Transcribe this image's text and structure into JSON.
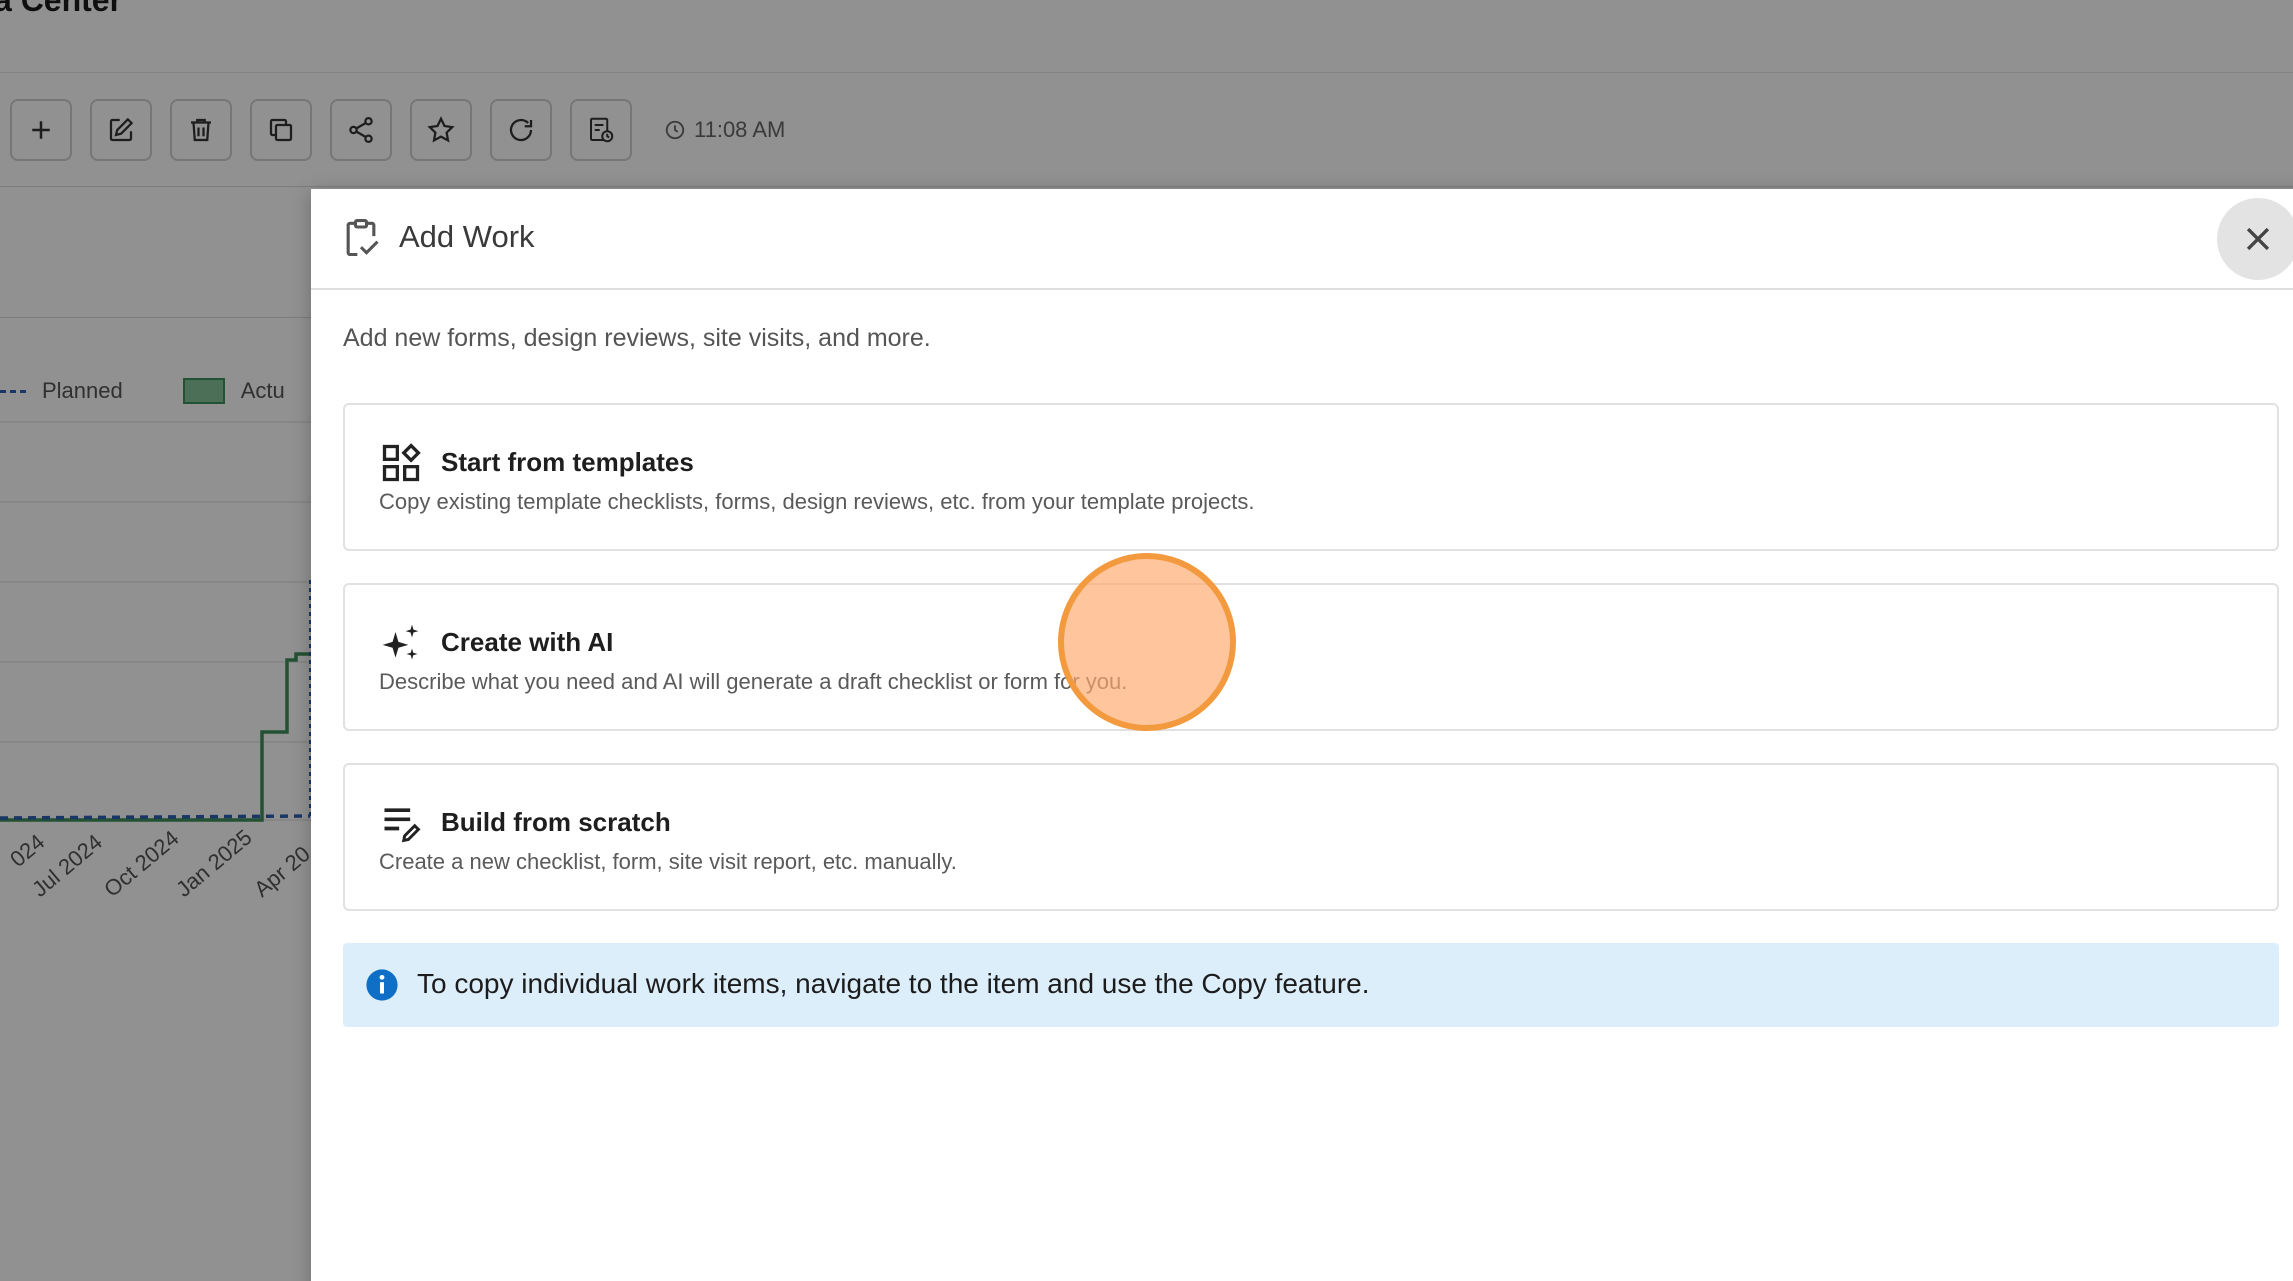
{
  "background": {
    "page_title": "a Center",
    "toolbar": {
      "buttons": [
        {
          "icon": "plus-icon"
        },
        {
          "icon": "edit-icon"
        },
        {
          "icon": "trash-icon"
        },
        {
          "icon": "copy-icon"
        },
        {
          "icon": "share-icon"
        },
        {
          "icon": "star-icon"
        },
        {
          "icon": "refresh-icon"
        },
        {
          "icon": "report-schedule-icon"
        }
      ],
      "time": "11:08 AM"
    },
    "chart": {
      "legend": {
        "planned": "Planned",
        "actual": "Actu"
      },
      "colors": {
        "planned": "#2f5fb3",
        "actual_fill": "#86c49b",
        "actual_line": "#3d8f5a"
      }
    }
  },
  "chart_data": {
    "type": "line",
    "x": [
      "024",
      "Jul 2024",
      "Oct 2024",
      "Jan 2025",
      "Apr 20"
    ],
    "series": [
      {
        "name": "Planned",
        "style": "dashed",
        "color": "#2f5fb3"
      },
      {
        "name": "Actu",
        "style": "step-area",
        "color": "#3d8f5a"
      }
    ]
  },
  "modal": {
    "title": "Add Work",
    "title_icon": "clipboard-check-icon",
    "close_icon": "close-icon",
    "subtitle": "Add new forms, design reviews, site visits, and more.",
    "options": [
      {
        "icon": "templates-icon",
        "title": "Start from templates",
        "description": "Copy existing template checklists, forms, design reviews, etc. from your template projects."
      },
      {
        "icon": "sparkles-icon",
        "title": "Create with AI",
        "description": "Describe what you need and AI will generate a draft checklist or form for you."
      },
      {
        "icon": "list-edit-icon",
        "title": "Build from scratch",
        "description": "Create a new checklist, form, site visit report, etc. manually."
      }
    ],
    "info": {
      "icon": "info-icon",
      "text": "To copy individual work items, navigate to the item and use the Copy feature.",
      "color": "#0f6fc6"
    }
  },
  "click_indicator_color": "#f39a3e"
}
